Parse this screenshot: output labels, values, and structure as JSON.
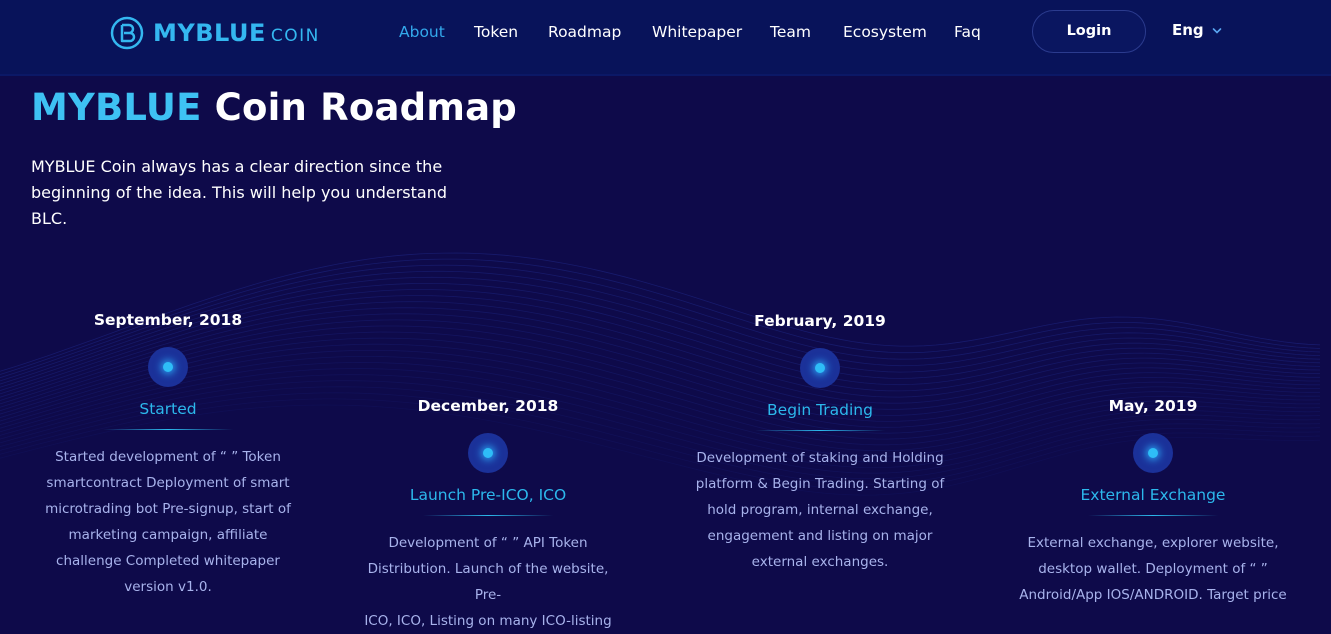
{
  "header": {
    "logo": {
      "brand": "MYBLUE",
      "suffix": "COIN"
    },
    "nav": [
      {
        "label": "About",
        "active": true
      },
      {
        "label": "Token",
        "active": false
      },
      {
        "label": "Roadmap",
        "active": false
      },
      {
        "label": "Whitepaper",
        "active": false
      },
      {
        "label": "Team",
        "active": false
      },
      {
        "label": "Ecosystem",
        "active": false
      },
      {
        "label": "Faq",
        "active": false
      }
    ],
    "login_label": "Login",
    "language": "Eng"
  },
  "hero": {
    "title_highlight": "MYBLUE",
    "title_rest": " Coin Roadmap",
    "intro_line1": "MYBLUE Coin always has a clear direction since the",
    "intro_line2": "beginning of the idea. This will help you understand BLC."
  },
  "milestones": [
    {
      "date": "September, 2018",
      "title": "Started",
      "description": [
        "Started development of “ ” Token",
        "smartcontract Deployment of smart",
        "microtrading bot Pre-signup, start of",
        "marketing campaign, affiliate",
        "challenge Completed whitepaper",
        "version v1.0."
      ]
    },
    {
      "date": "December, 2018",
      "title": "Launch Pre-ICO, ICO",
      "description": [
        "Development of “ ” API Token",
        "Distribution. Launch of the website, Pre-",
        "ICO, ICO, Listing on many ICO-listing"
      ]
    },
    {
      "date": "February, 2019",
      "title": "Begin Trading",
      "description": [
        "Development of staking and Holding",
        "platform & Begin Trading. Starting of",
        "hold program, internal exchange,",
        "engagement and listing on major",
        "external exchanges."
      ]
    },
    {
      "date": "May, 2019",
      "title": "External Exchange",
      "description": [
        "External exchange, explorer website,",
        "desktop wallet. Deployment of “ ”",
        "Android/App IOS/ANDROID. Target price"
      ]
    }
  ],
  "colors": {
    "background": "#0e0a4a",
    "header": "#08135a",
    "accent": "#34b7f0",
    "description_text": "#a8b3ec"
  },
  "icons": {
    "logo": "coin-logo-icon",
    "language_dropdown": "chevron-down-icon",
    "timeline_node": "glowing-dot-icon"
  }
}
